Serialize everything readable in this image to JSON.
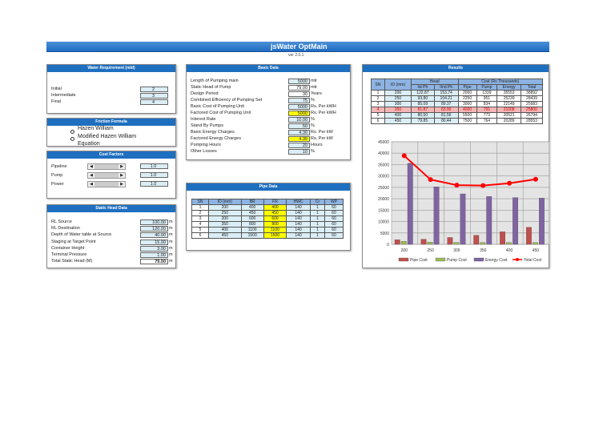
{
  "title": "jsWater OptMain",
  "version": "ver 2.0.1",
  "water_requirement": {
    "header": "Water Requirement (mld)",
    "rows": [
      {
        "label": "Initial",
        "value": "2"
      },
      {
        "label": "Intermediate",
        "value": "3"
      },
      {
        "label": "Final",
        "value": "4"
      }
    ]
  },
  "friction": {
    "header": "Friction Formula",
    "options": [
      "Hazen William",
      "Modified Hazen William Equation"
    ]
  },
  "cost_factors": {
    "header": "Cost Factors",
    "rows": [
      {
        "label": "Pipeline",
        "value": "1.0"
      },
      {
        "label": "Pump",
        "value": "1.0"
      },
      {
        "label": "Power",
        "value": "1.0"
      }
    ]
  },
  "static_head": {
    "header": "Static Head Data",
    "rows": [
      {
        "label": "RL Source",
        "value": "100.00",
        "unit": "m"
      },
      {
        "label": "RL Destination",
        "value": "120.00",
        "unit": "m"
      },
      {
        "label": "Depth of Water table at Source",
        "value": "40.00",
        "unit": "m"
      },
      {
        "label": "Staging at Target Point",
        "value": "15.00",
        "unit": "m"
      },
      {
        "label": "Container Height",
        "value": "3.00",
        "unit": "m"
      },
      {
        "label": "Terminal Pressure",
        "value": "1.00",
        "unit": "m"
      },
      {
        "label": "Total Static Head (M)",
        "value": "79.00",
        "unit": "m"
      }
    ]
  },
  "basic_data": {
    "header": "Basic Data",
    "rows": [
      {
        "label": "Length of Pumping main",
        "value": "5000",
        "unit": "mtr"
      },
      {
        "label": "Static Head of Pump",
        "value": "79.00",
        "unit": "mtr"
      },
      {
        "label": "Design Period",
        "value": "30",
        "unit": "Years"
      },
      {
        "label": "Combined Efficiency of Pumping Set",
        "value": "75",
        "unit": "%"
      },
      {
        "label": "Basic Cost of Pumping Unit",
        "value": "5000",
        "unit": "Rs. Per kWH"
      },
      {
        "label": "Factored Cost of Pumping Unit",
        "value": "5000",
        "unit": "Rs. Per kWH"
      },
      {
        "label": "Interest Rate",
        "value": "10.00",
        "unit": "%"
      },
      {
        "label": "Stand By Pumps",
        "value": "50",
        "unit": "%"
      },
      {
        "label": "Basic Energy Charges",
        "value": "4.30",
        "unit": "Rs. Per kW"
      },
      {
        "label": "Factored Energy Charges",
        "value": "4.30",
        "unit": "Rs. Per kW"
      },
      {
        "label": "Pumping Hours",
        "value": "20",
        "unit": "Hours"
      },
      {
        "label": "Other Losses",
        "value": "10",
        "unit": "%"
      }
    ]
  },
  "pipe_data": {
    "header": "Pipe Data",
    "columns": [
      "SN",
      "ID (mm)",
      "BR",
      "FR",
      "HWC",
      "Cr",
      "WP"
    ],
    "rows": [
      [
        "1",
        "200",
        "400",
        "400",
        "140",
        "1",
        "60"
      ],
      [
        "2",
        "250",
        "450",
        "450",
        "140",
        "1",
        "60"
      ],
      [
        "3",
        "300",
        "600",
        "600",
        "140",
        "1",
        "60"
      ],
      [
        "4",
        "350",
        "800",
        "800",
        "140",
        "1",
        "60"
      ],
      [
        "5",
        "400",
        "1100",
        "1100",
        "140",
        "1",
        "60"
      ],
      [
        "6",
        "450",
        "1500",
        "1500",
        "140",
        "1",
        "60"
      ]
    ]
  },
  "results": {
    "header": "Results",
    "group_head": "Head",
    "group_cost": "Cost (Rs Thousands)",
    "columns": [
      "SN",
      "ID (mm)",
      "Ist Ph",
      "IInd Ph",
      "Pipe",
      "Pump",
      "Energy",
      "Total"
    ],
    "rows": [
      [
        "1",
        "200",
        "122.87",
        "153.74",
        "2000",
        "1339",
        "35553",
        "38892"
      ],
      [
        "2",
        "250",
        "93.80",
        "104.21",
        "2250",
        "951",
        "25239",
        "28439"
      ],
      [
        "3",
        "300",
        "85.09",
        "89.37",
        "3000",
        "834",
        "22149",
        "25983"
      ],
      [
        "4",
        "350",
        "81.87",
        "83.90",
        "4000",
        "791",
        "21008",
        "25800"
      ],
      [
        "5",
        "400",
        "80.50",
        "81.56",
        "5500",
        "773",
        "20521",
        "26794"
      ],
      [
        "6",
        "450",
        "79.85",
        "80.44",
        "7500",
        "764",
        "20289",
        "28553"
      ]
    ]
  },
  "chart_data": {
    "type": "bar",
    "categories": [
      "200",
      "250",
      "300",
      "350",
      "400",
      "450"
    ],
    "ylim": [
      0,
      45000
    ],
    "yticks": [
      "0",
      "5000",
      "10000",
      "15000",
      "20000",
      "25000",
      "30000",
      "35000",
      "40000",
      "45000"
    ],
    "series": [
      {
        "name": "Pipe Cost",
        "type": "bar",
        "color": "#c0504d",
        "values": [
          2000,
          2250,
          3000,
          4000,
          5500,
          7500
        ]
      },
      {
        "name": "Pump Cost",
        "type": "bar",
        "color": "#9bbb59",
        "values": [
          1339,
          951,
          834,
          791,
          773,
          764
        ]
      },
      {
        "name": "Energy Cost",
        "type": "bar",
        "color": "#8064a2",
        "values": [
          35553,
          25239,
          22149,
          21008,
          20521,
          20289
        ]
      },
      {
        "name": "Total Cost",
        "type": "line",
        "color": "#ff0000",
        "values": [
          38892,
          28439,
          25983,
          25800,
          26794,
          28553
        ]
      }
    ]
  }
}
